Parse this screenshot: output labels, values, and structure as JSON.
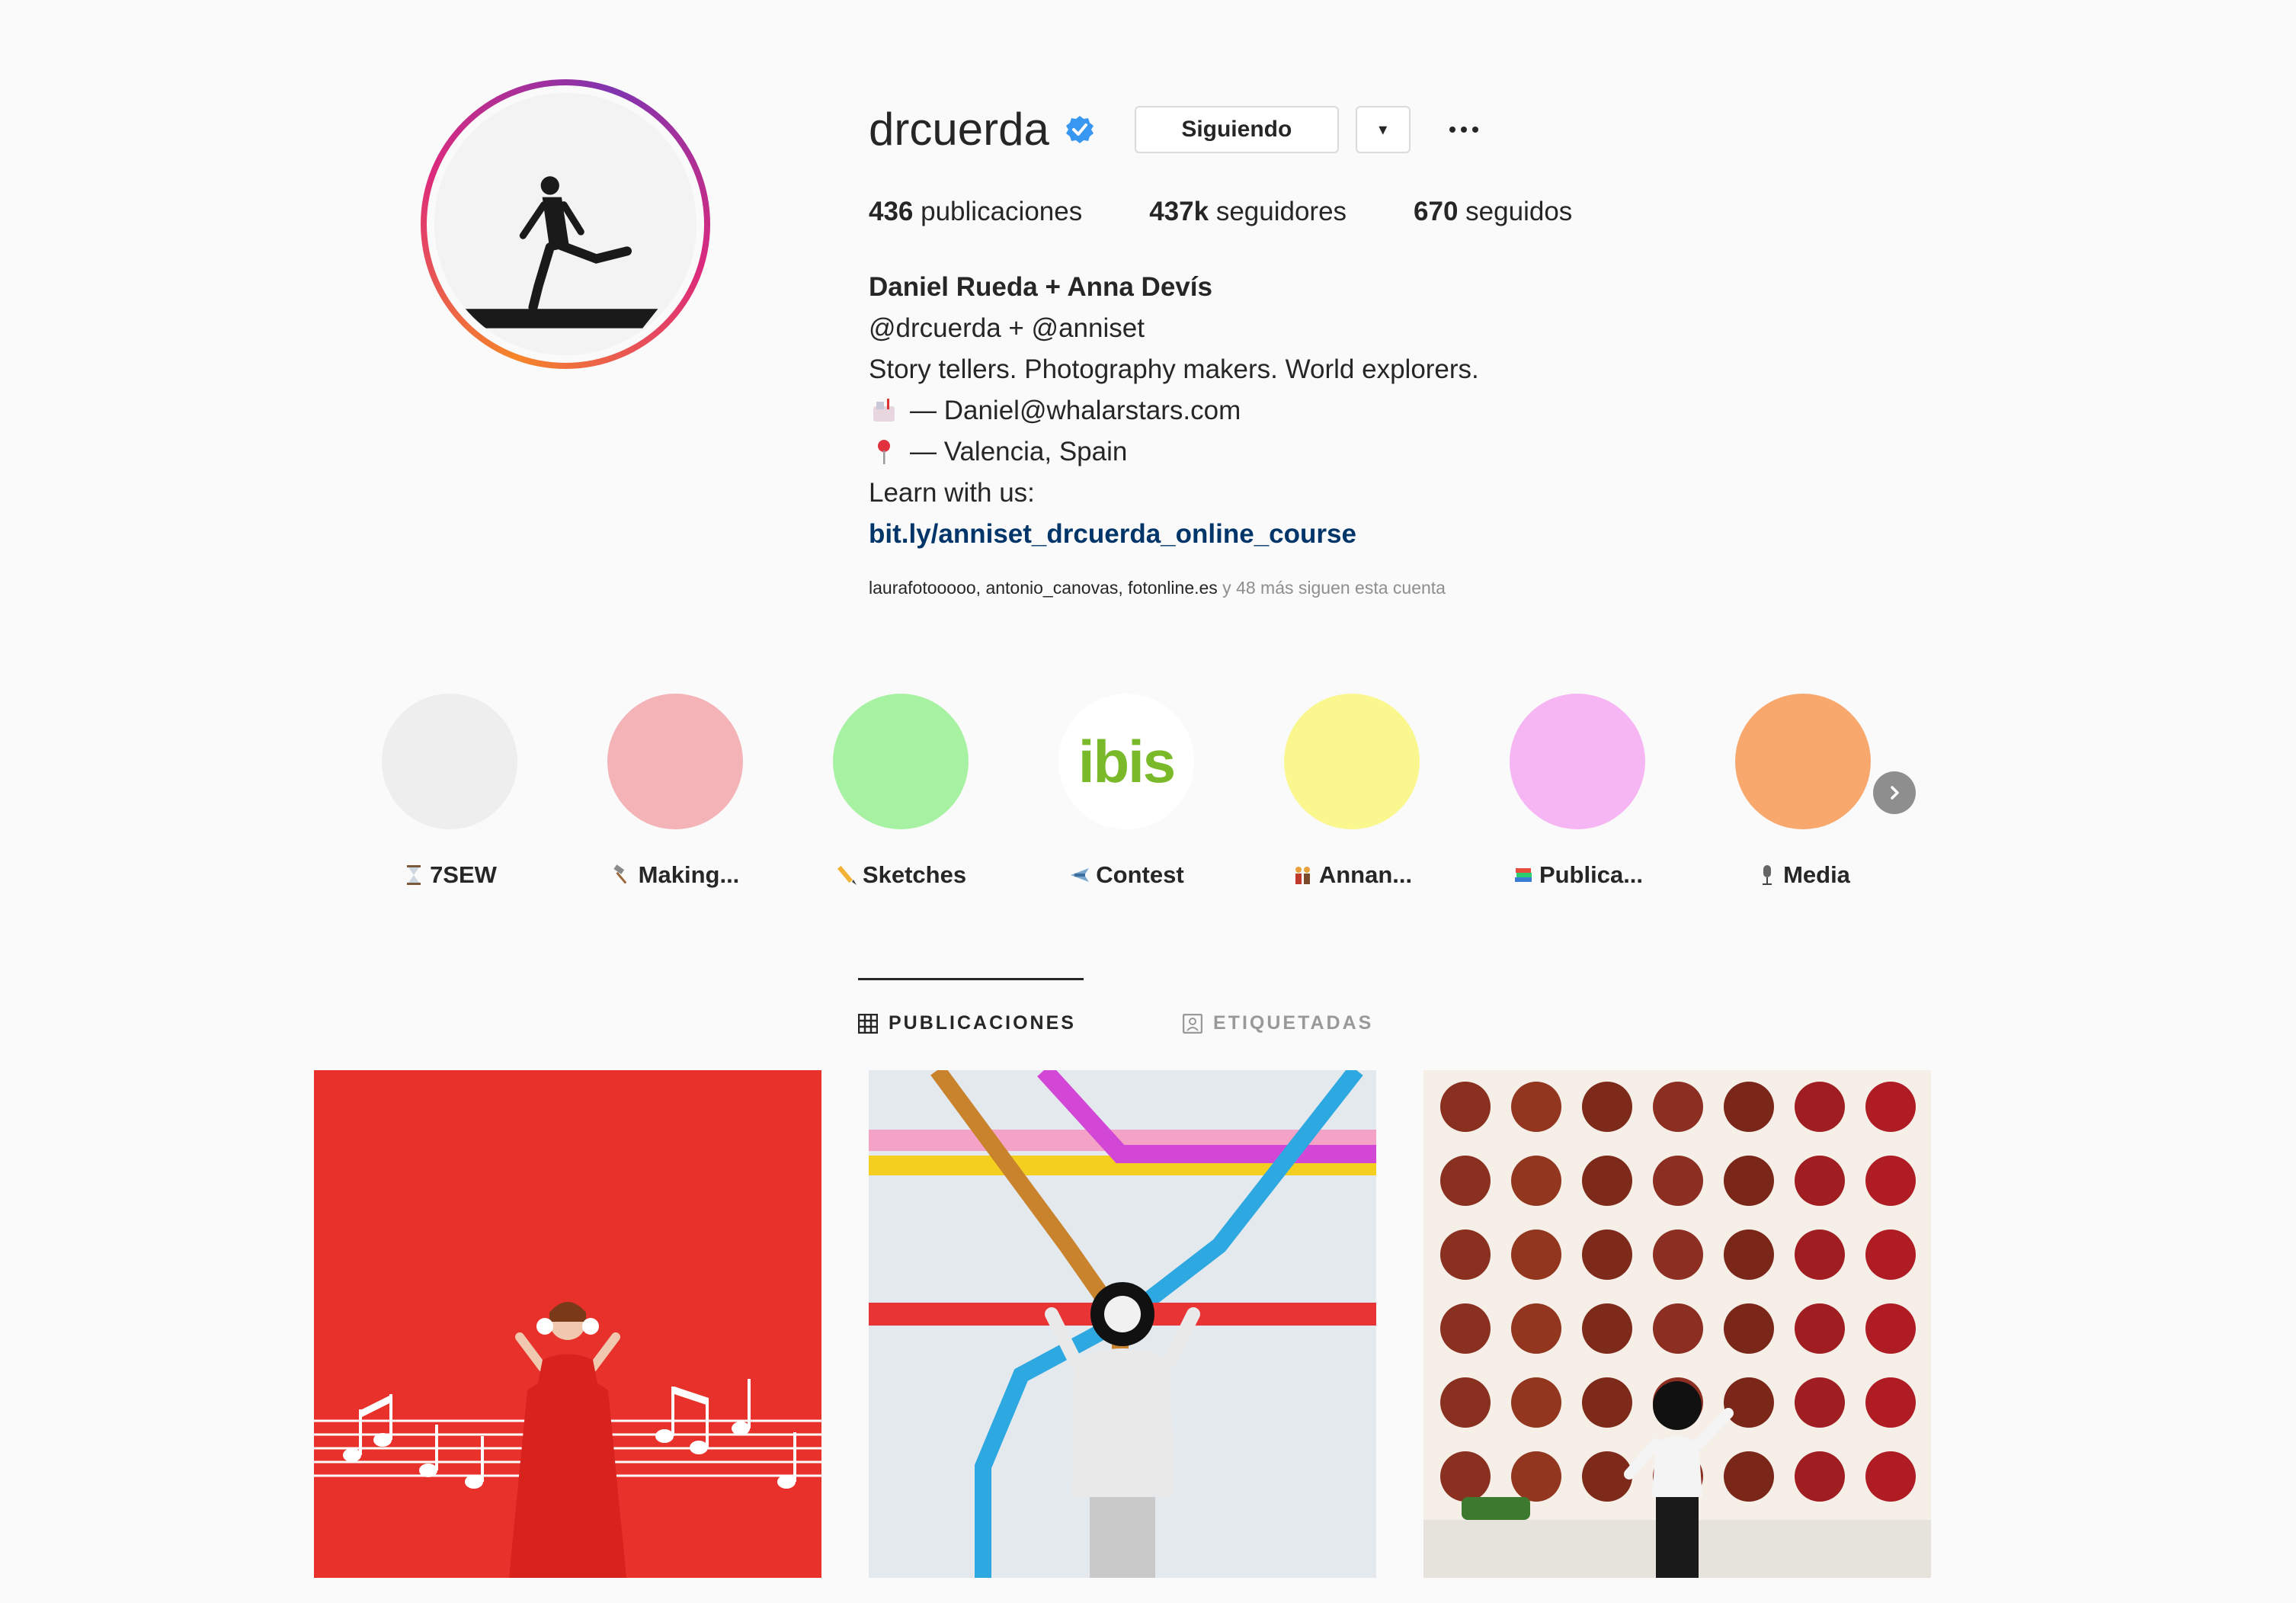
{
  "profile": {
    "username": "drcuerda",
    "follow_label": "Siguiendo",
    "dropdown_glyph": "▾",
    "stats": [
      {
        "count": "436",
        "label": " publicaciones"
      },
      {
        "count": "437k",
        "label": " seguidores"
      },
      {
        "count": "670",
        "label": " seguidos"
      }
    ],
    "full_name": "Daniel Rueda + Anna Devís",
    "bio_lines": [
      "@drcuerda + @anniset",
      "Story tellers. Photography makers. World explorers.",
      "— Daniel@whalarstars.com",
      "— Valencia, Spain",
      "Learn with us:"
    ],
    "link": "bit.ly/anniset_drcuerda_online_course",
    "followed_by_names": "laurafotooooo, antonio_canovas, fotonline.es",
    "followed_by_rest": " y 48 más siguen esta cuenta"
  },
  "highlights": [
    {
      "label": "7SEW",
      "color": "#eeeeee",
      "icon": "hourglass-icon"
    },
    {
      "label": "Making...",
      "color": "#f4b3b6",
      "icon": "hammer-icon"
    },
    {
      "label": "Sketches",
      "color": "#a7f1a3",
      "icon": "pencil-icon"
    },
    {
      "label": "Contest",
      "color": "#ffffff",
      "icon": "airplane-icon",
      "logo_text": "ibis"
    },
    {
      "label": "Annan...",
      "color": "#fbf78f",
      "icon": "people-icon"
    },
    {
      "label": "Publica...",
      "color": "#f5b6f3",
      "icon": "books-icon"
    },
    {
      "label": "Media",
      "color": "#f8a76d",
      "icon": "microphone-icon"
    }
  ],
  "tabs": [
    {
      "label": "PUBLICACIONES",
      "icon": "grid-icon",
      "active": true
    },
    {
      "label": "ETIQUETADAS",
      "icon": "tag-icon",
      "active": false
    }
  ],
  "colors": {
    "accent_link": "#003569",
    "verified": "#3897f0",
    "text": "#262626",
    "muted": "#8e8e8e"
  }
}
